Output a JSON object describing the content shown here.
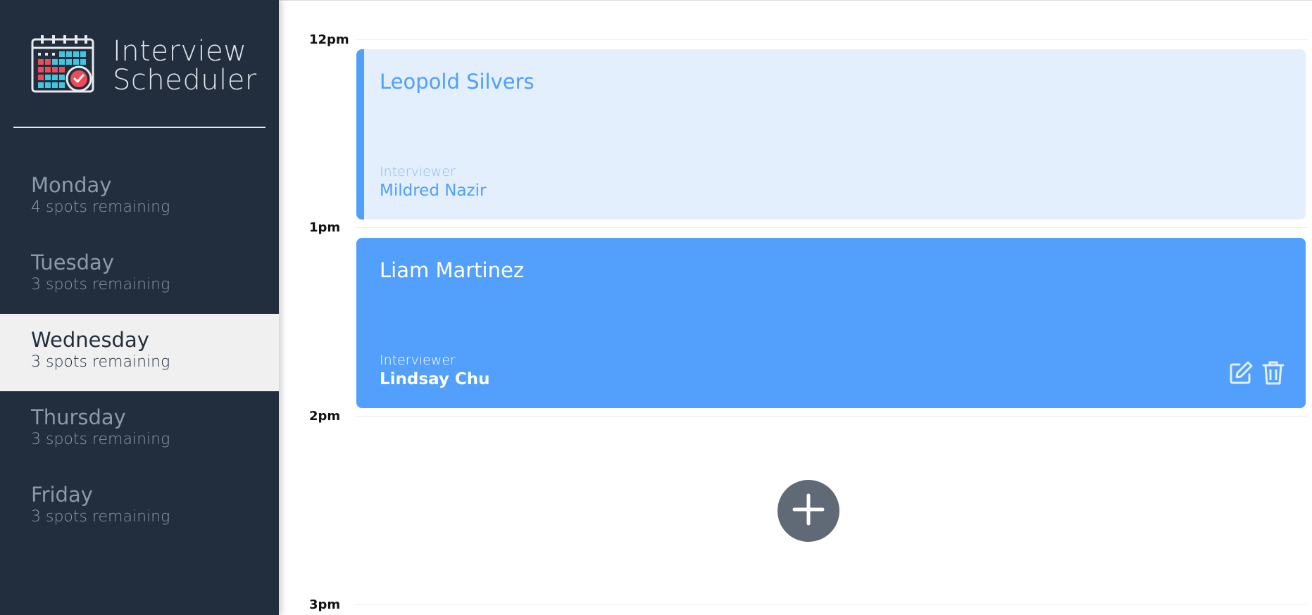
{
  "app": {
    "title_line1": "Interview",
    "title_line2": "Scheduler"
  },
  "colors": {
    "sidebar_bg": "#222e3e",
    "selected_day_bg": "#f0f0f0",
    "appointment_accent": "#509ffa",
    "appointment_light_bg": "#e3effc",
    "appointment_dark_bg": "#529ffc",
    "add_button_bg": "#5f6a76"
  },
  "days": [
    {
      "name": "Monday",
      "spots": "4 spots remaining",
      "selected": false
    },
    {
      "name": "Tuesday",
      "spots": "3 spots remaining",
      "selected": false
    },
    {
      "name": "Wednesday",
      "spots": "3 spots remaining",
      "selected": true
    },
    {
      "name": "Thursday",
      "spots": "3 spots remaining",
      "selected": false
    },
    {
      "name": "Friday",
      "spots": "3 spots remaining",
      "selected": false
    }
  ],
  "times": [
    "12pm",
    "1pm",
    "2pm",
    "3pm"
  ],
  "appointments": [
    {
      "student": "Leopold Silvers",
      "interviewer_label": "Interviewer",
      "interviewer": "Mildred Nazir"
    },
    {
      "student": "Liam Martinez",
      "interviewer_label": "Interviewer",
      "interviewer": "Lindsay Chu"
    }
  ],
  "icons": {
    "logo": "calendar-check-icon",
    "edit": "edit-icon",
    "delete": "trash-icon",
    "add": "plus-icon"
  }
}
